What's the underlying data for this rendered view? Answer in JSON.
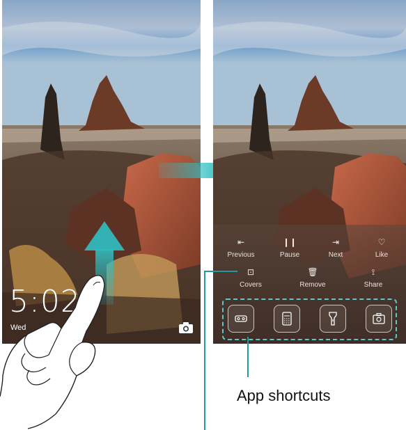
{
  "left_phone": {
    "time": "5:02",
    "date": "Wed"
  },
  "right_phone": {
    "music_controls": [
      {
        "label": "Previous",
        "icon": "previous-icon",
        "glyph": "⇤"
      },
      {
        "label": "Pause",
        "icon": "pause-icon",
        "glyph": "❙❙"
      },
      {
        "label": "Next",
        "icon": "next-icon",
        "glyph": "⇥"
      },
      {
        "label": "Like",
        "icon": "heart-icon",
        "glyph": "♡"
      }
    ],
    "row2": [
      {
        "label": "Covers",
        "icon": "covers-icon",
        "glyph": "⊡"
      },
      {
        "label": "Remove",
        "icon": "trash-icon",
        "glyph": "🗑"
      },
      {
        "label": "Share",
        "icon": "share-icon",
        "glyph": "⟟"
      }
    ],
    "shortcuts": [
      "voice-recorder-icon",
      "calculator-icon",
      "flashlight-icon",
      "camera-icon"
    ]
  },
  "annotation": {
    "label": "App shortcuts"
  },
  "colors": {
    "accent": "#1e9aa0",
    "dashed_border": "#5cc8c8"
  }
}
